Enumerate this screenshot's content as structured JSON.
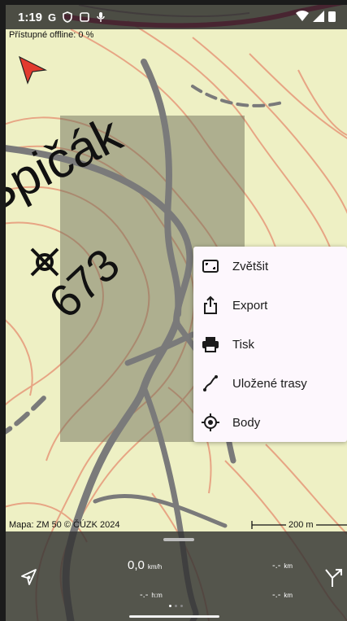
{
  "status": {
    "time": "1:19",
    "g_letter": "G"
  },
  "map": {
    "offline_text": "Přístupné offline: 0 %",
    "summit_name": "Špičák",
    "summit_height": "673",
    "attribution": "Mapa: ZM 50 © ČÚZK 2024",
    "scale": "200 m"
  },
  "menu": {
    "items": [
      {
        "label": "Zvětšit",
        "icon": "fullscreen-icon"
      },
      {
        "label": "Export",
        "icon": "share-icon"
      },
      {
        "label": "Tisk",
        "icon": "print-icon"
      },
      {
        "label": "Uložené trasy",
        "icon": "route-icon"
      },
      {
        "label": "Body",
        "icon": "crosshair-icon"
      }
    ]
  },
  "sheet": {
    "speed_value": "0,0",
    "speed_unit": "km/h",
    "distance1_value": "-.-",
    "distance1_unit": "km",
    "time_value": "-.-",
    "time_unit": "h:m",
    "distance2_value": "-.-",
    "distance2_unit": "km",
    "pages": 3,
    "active_page": 1
  },
  "colors": {
    "map_bg": "#eef0c4",
    "contour": "#e6987a",
    "road": "#7a7a7a",
    "main_road": "#d81b5c",
    "menu_bg": "#fdf7fd"
  }
}
